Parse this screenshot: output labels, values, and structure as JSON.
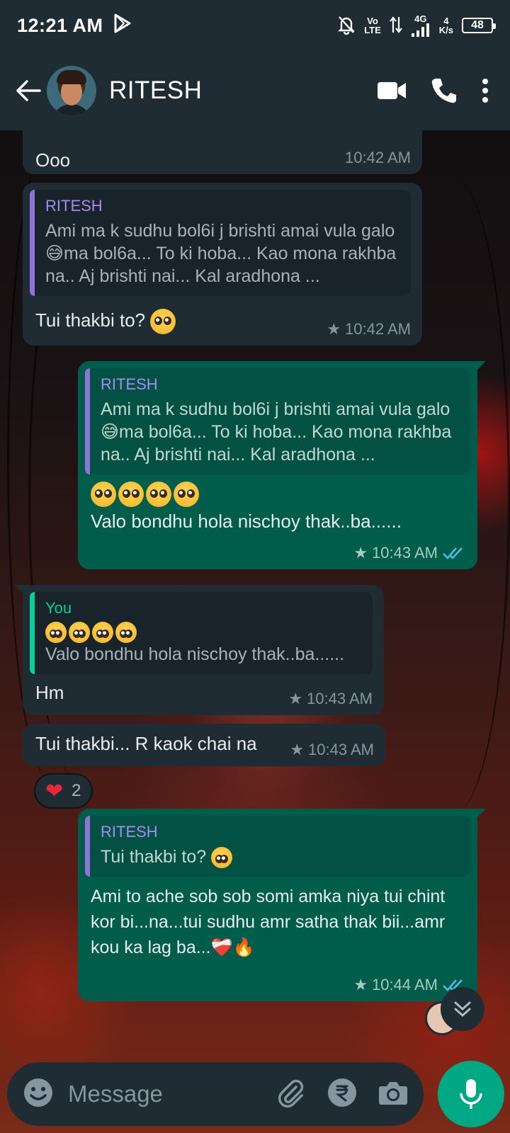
{
  "status_bar": {
    "time": "12:21 AM",
    "network_top": "Vo",
    "network_bottom": "LTE",
    "signal_label": "4G",
    "speed_top": "4",
    "speed_bottom": "K/s",
    "battery": "48"
  },
  "header": {
    "contact_name": "RITESH"
  },
  "messages": [
    {
      "text": "Ooo",
      "time": "10:42 AM"
    },
    {
      "quote_author": "RITESH",
      "quote_text": "Ami ma k sudhu bol6i j brishti amai vula galo😅ma bol6a... To ki hoba... Kao mona rakhba na.. Aj brishti nai... Kal aradhona ...",
      "text": "Tui thakbi to?",
      "time": "10:42 AM"
    },
    {
      "quote_author": "RITESH",
      "quote_text": "Ami ma k sudhu bol6i j brishti amai vula galo😅ma bol6a... To ki hoba... Kao mona rakhba na.. Aj brishti nai... Kal aradhona ...",
      "text": "Valo bondhu hola nischoy thak..ba......",
      "time": "10:43 AM"
    },
    {
      "quote_author": "You",
      "quote_text": "Valo bondhu hola nischoy thak..ba......",
      "text": "Hm",
      "time": "10:43 AM"
    },
    {
      "text": "Tui thakbi... R kaok chai na",
      "time": "10:43 AM",
      "reaction_count": "2"
    },
    {
      "quote_author": "RITESH",
      "quote_text": "Tui thakbi to?",
      "text": "Ami to ache sob sob somi amka niya tui chint kor bi...na...tui sudhu amr satha thak bii...amr kou ka lag ba...❤️‍🩹🔥",
      "time": "10:44 AM"
    }
  ],
  "composer": {
    "placeholder": "Message"
  },
  "colors": {
    "header_bg": "#1f2c34",
    "incoming_bubble": "#1f2c34",
    "outgoing_bubble": "#005c4b",
    "accent": "#00a884",
    "read_tick": "#53bdeb"
  }
}
